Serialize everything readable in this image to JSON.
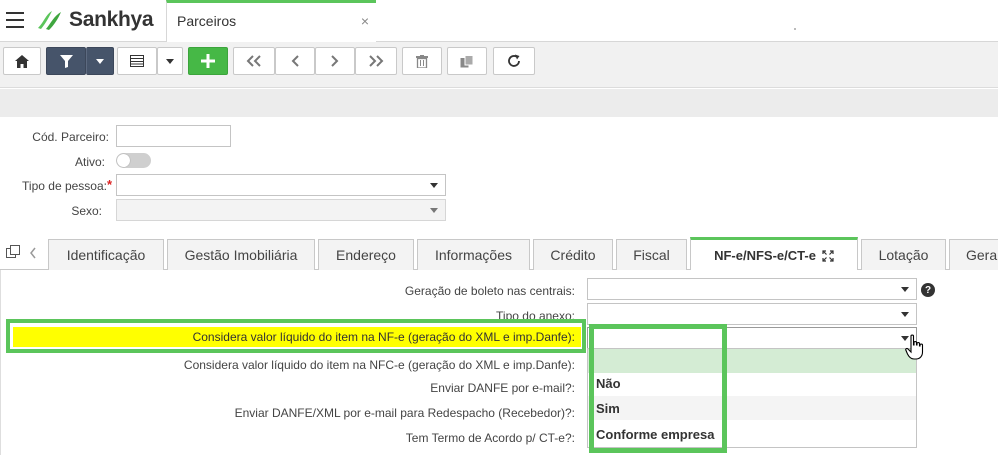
{
  "app": {
    "logo_text": "Sankhya",
    "tab_title": "Parceiros",
    "tab_close": "×"
  },
  "toolbar": {
    "icons": [
      "home-icon",
      "filter-icon",
      "chevron-down-icon",
      "grid-icon",
      "chevron-down-icon",
      "add-icon",
      "first-icon",
      "previous-icon",
      "next-icon",
      "last-icon",
      "trash-icon",
      "copy-icon",
      "refresh-icon"
    ]
  },
  "form": {
    "cod_parceiro_label": "Cód. Parceiro:",
    "cod_parceiro_value": "",
    "ativo_label": "Ativo:",
    "tipo_pessoa_label": "Tipo de pessoa:",
    "required_mark": "*",
    "tipo_pessoa_value": "",
    "sexo_label": "Sexo:",
    "sexo_value": ""
  },
  "tabs": [
    {
      "label": "Identificação"
    },
    {
      "label": "Gestão Imobiliária"
    },
    {
      "label": "Endereço"
    },
    {
      "label": "Informações"
    },
    {
      "label": "Crédito"
    },
    {
      "label": "Fiscal"
    },
    {
      "label": "NF-e/NFS-e/CT-e"
    },
    {
      "label": "Lotação"
    },
    {
      "label": "Gera"
    }
  ],
  "nfe_panel": {
    "fields": [
      {
        "label": "Geração de boleto nas centrais:"
      },
      {
        "label": "Tipo do anexo:"
      },
      {
        "label": "Considera valor líquido do item na NF-e (geração do XML e imp.Danfe):"
      },
      {
        "label": "Considera valor líquido do item na NFC-e (geração do XML e imp.Danfe):"
      },
      {
        "label": "Enviar DANFE por e-mail?:"
      },
      {
        "label": "Enviar DANFE/XML por e-mail para Redespacho (Recebedor)?:"
      },
      {
        "label": "Tem Termo de Acordo p/ CT-e?:"
      }
    ],
    "help": "?"
  },
  "dropdown": {
    "options": [
      "",
      "Não",
      "Sim",
      "Conforme empresa"
    ]
  },
  "colors": {
    "accent_green": "#5bc55b",
    "highlight_yellow": "#ffff00",
    "toolbar_dark": "#46546a"
  }
}
